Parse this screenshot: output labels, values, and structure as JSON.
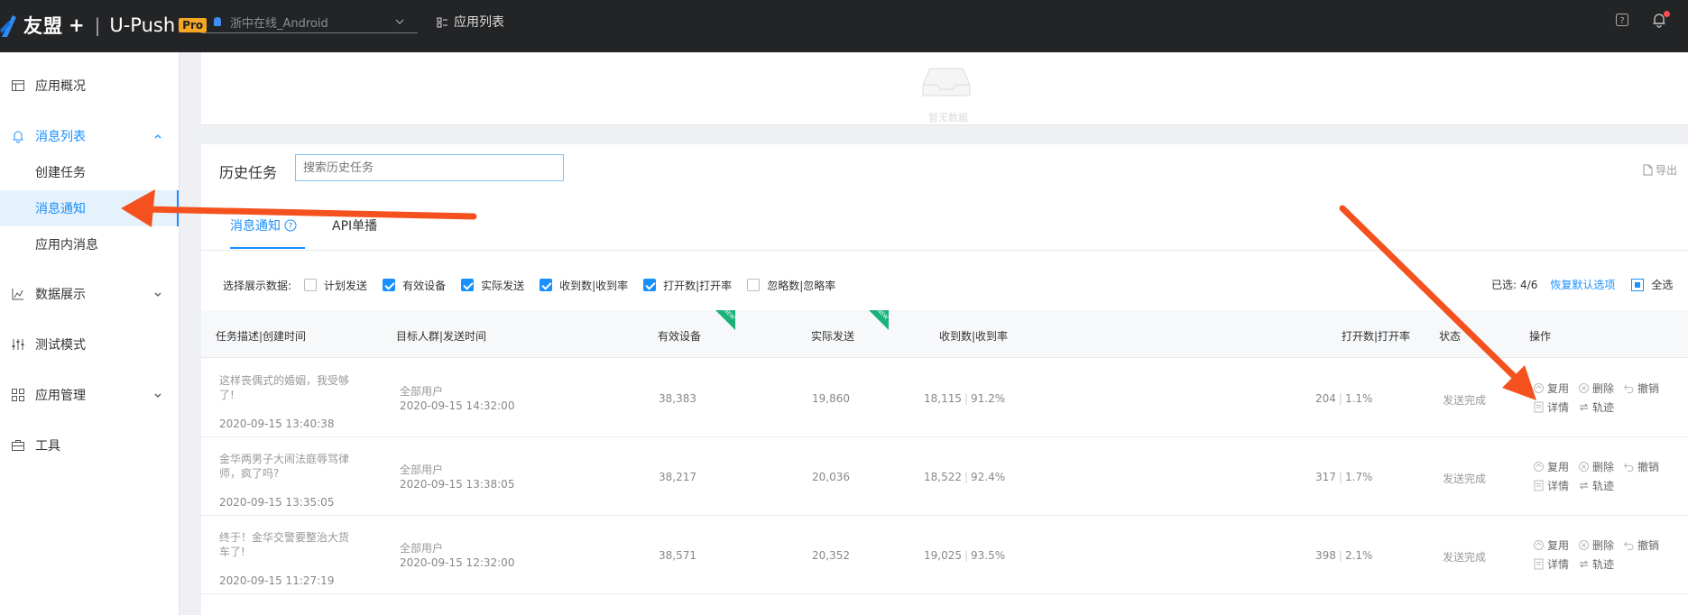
{
  "topbar": {
    "brand": "友盟",
    "brand_plus": "+",
    "sep": "|",
    "product": "U-Push",
    "pro_badge": "Pro",
    "app_name": "浙中在线_Android",
    "app_list_label": "应用列表"
  },
  "sidebar": {
    "items": [
      {
        "label": "应用概况",
        "icon": "overview-icon"
      },
      {
        "label": "消息列表",
        "icon": "bell-icon"
      },
      {
        "label": "数据展示",
        "icon": "chart-icon"
      },
      {
        "label": "测试模式",
        "icon": "sliders-icon"
      },
      {
        "label": "应用管理",
        "icon": "grid-icon"
      },
      {
        "label": "工具",
        "icon": "toolbox-icon"
      }
    ],
    "sub_items": [
      "创建任务",
      "消息通知",
      "应用内消息"
    ]
  },
  "empty": {
    "text": "暂无数据"
  },
  "history": {
    "title": "历史任务",
    "search_placeholder": "搜索历史任务",
    "export_label": "导出"
  },
  "tabs": {
    "notify": "消息通知",
    "api": "API单播"
  },
  "filters": {
    "label": "选择展示数据:",
    "options": [
      {
        "label": "计划发送",
        "checked": false
      },
      {
        "label": "有效设备",
        "checked": true
      },
      {
        "label": "实际发送",
        "checked": true
      },
      {
        "label": "收到数|收到率",
        "checked": true
      },
      {
        "label": "打开数|打开率",
        "checked": true
      },
      {
        "label": "忽略数|忽略率",
        "checked": false
      }
    ],
    "selected_prefix": "已选:",
    "selected_count": "4/6",
    "restore_label": "恢复默认选项",
    "select_all_label": "全选"
  },
  "table": {
    "headers": [
      "任务描述|创建时间",
      "目标人群|发送时间",
      "有效设备",
      "实际发送",
      "收到数|收到率",
      "打开数|打开率",
      "状态",
      "操作"
    ],
    "new_tag": "NEW",
    "rows": [
      {
        "desc": "这样丧偶式的婚姻，我受够了!",
        "created": "2020-09-15 13:40:38",
        "target": "全部用户",
        "sent": "2020-09-15 14:32:00",
        "valid": "38,383",
        "actual": "19,860",
        "recv": "18,115",
        "recv_rate": "91.2%",
        "open": "204",
        "open_rate": "1.1%",
        "status": "发送完成"
      },
      {
        "desc": "金华两男子大闹法庭辱骂律师，疯了吗?",
        "created": "2020-09-15 13:35:05",
        "target": "全部用户",
        "sent": "2020-09-15 13:38:05",
        "valid": "38,217",
        "actual": "20,036",
        "recv": "18,522",
        "recv_rate": "92.4%",
        "open": "317",
        "open_rate": "1.7%",
        "status": "发送完成"
      },
      {
        "desc": "终于！金华交警要整治大货车了!",
        "created": "2020-09-15 11:27:19",
        "target": "全部用户",
        "sent": "2020-09-15 12:32:00",
        "valid": "38,571",
        "actual": "20,352",
        "recv": "19,025",
        "recv_rate": "93.5%",
        "open": "398",
        "open_rate": "2.1%",
        "status": "发送完成"
      }
    ],
    "ops": {
      "reuse": "复用",
      "delete": "删除",
      "revoke": "撤销",
      "detail": "详情",
      "track": "轨迹"
    }
  },
  "colors": {
    "accent": "#1890ff",
    "topbar": "#232426",
    "annotation": "#f4511e",
    "new_tag": "#19b27a"
  }
}
